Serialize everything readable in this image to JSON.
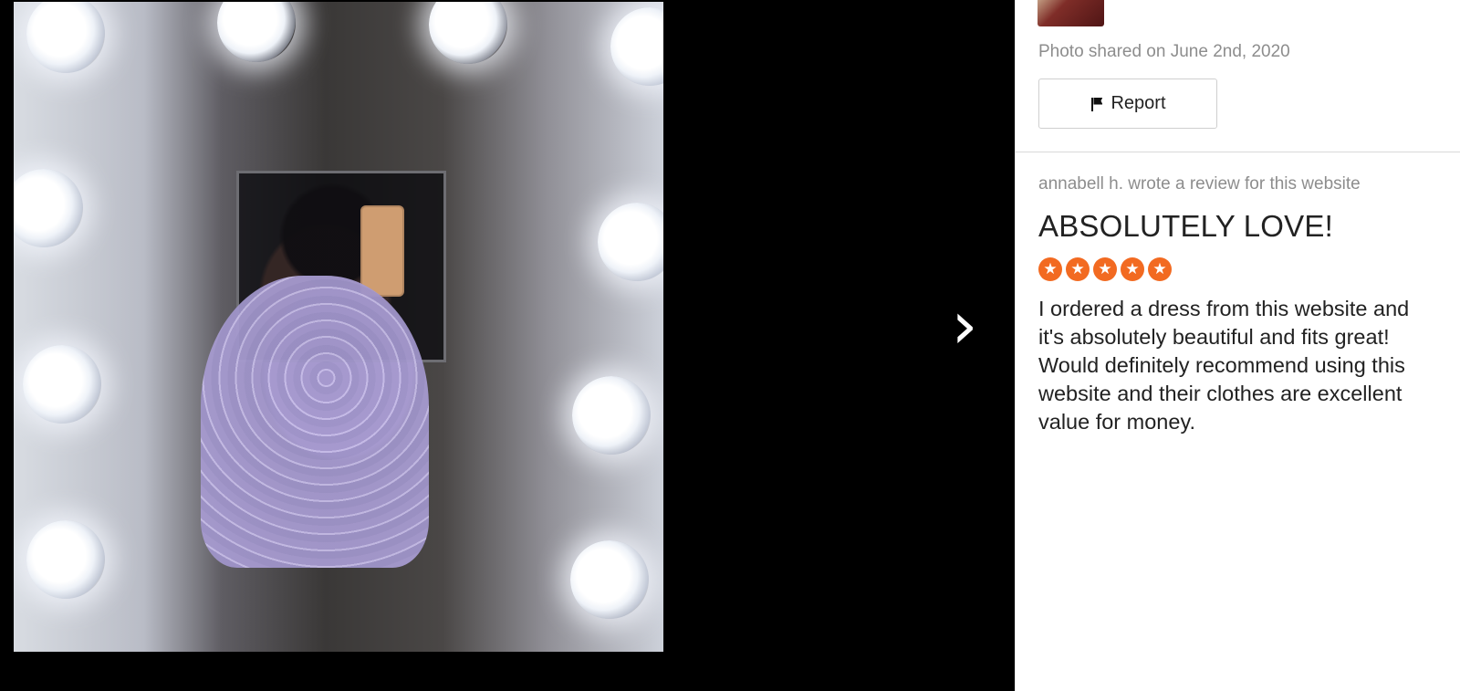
{
  "photo": {
    "alt": "Woman in lavender floral mini dress taking mirror selfie"
  },
  "viewer": {
    "next_icon": "chevron-right-icon"
  },
  "sidebar": {
    "shared_text": "Photo shared on June 2nd, 2020",
    "report_label": "Report",
    "report_icon": "flag-icon"
  },
  "review": {
    "meta": "annabell h. wrote a review for this website",
    "title": "ABSOLUTELY LOVE!",
    "rating": 5,
    "rating_color": "#f26a21",
    "body": "I ordered a dress from this website and it's absolutely beautiful and fits great! Would definitely recommend using this website and their clothes are excellent value for money."
  }
}
